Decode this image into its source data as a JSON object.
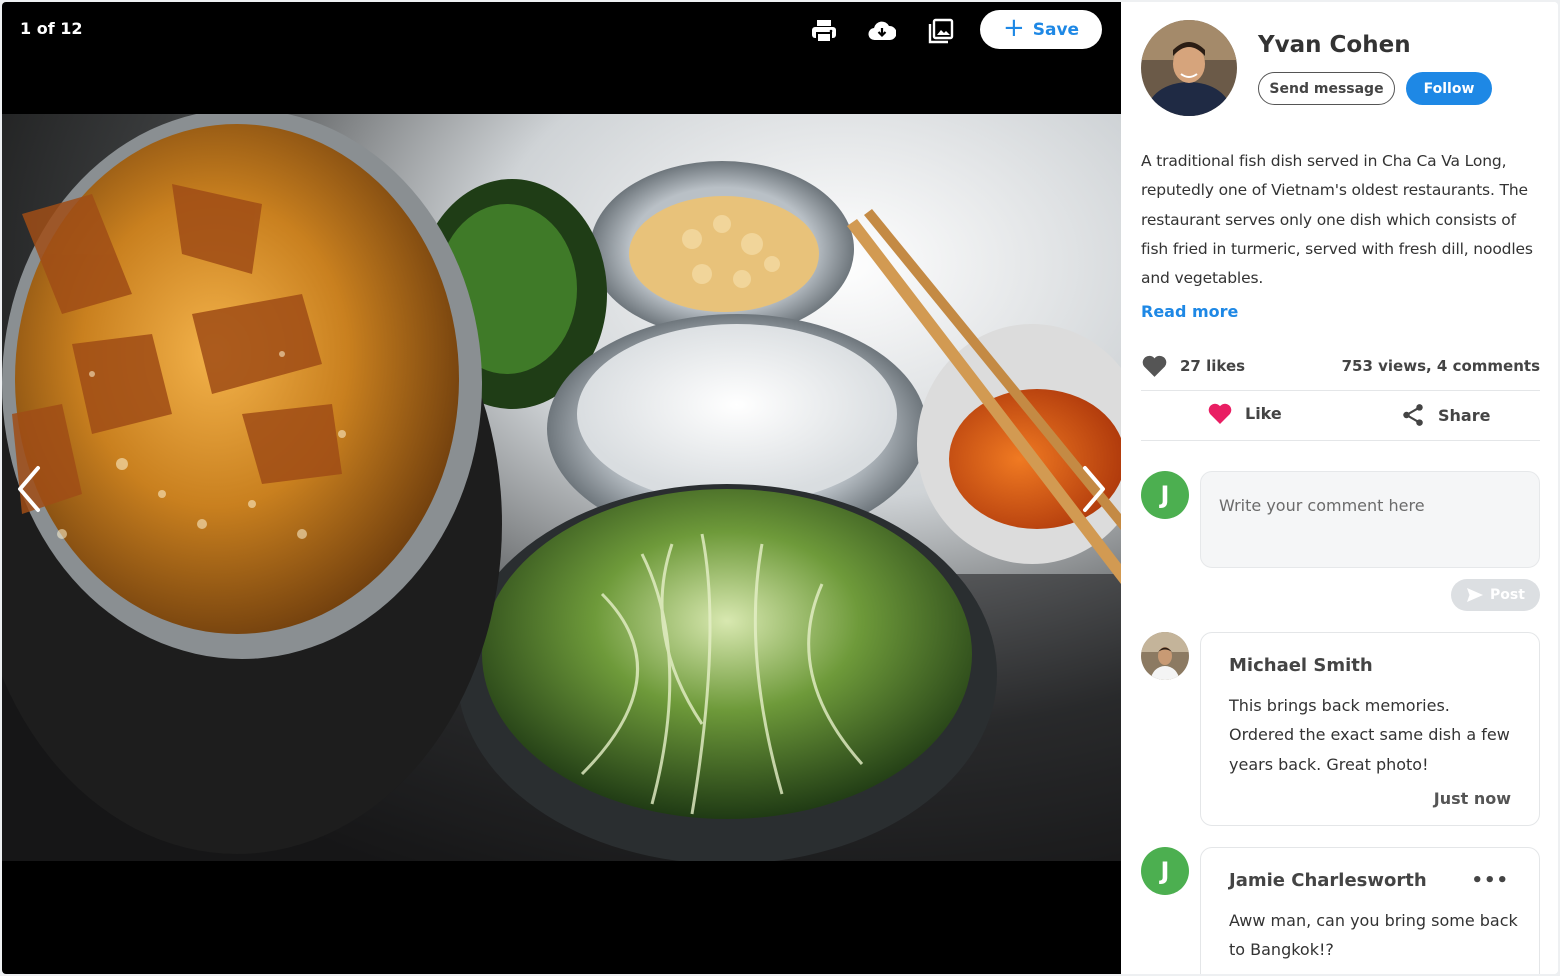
{
  "viewer": {
    "counter": "1 of 12",
    "save_label": "Save",
    "icons": [
      "print-icon",
      "download-icon",
      "gallery-icon",
      "plus-icon",
      "chevron-left-icon",
      "chevron-right-icon"
    ]
  },
  "author": {
    "name": "Yvan Cohen",
    "send_message_label": "Send message",
    "follow_label": "Follow"
  },
  "post": {
    "description": "A traditional fish dish served in Cha Ca Va Long, reputedly one of Vietnam's oldest restaurants. The restaurant serves only one dish which consists of fish fried in turmeric, served with fresh dill, noodles and vegetables.",
    "read_more_label": "Read more",
    "likes": "27 likes",
    "views_comments": "753 views, 4 comments",
    "like_label": "Like",
    "share_label": "Share"
  },
  "composer": {
    "avatar_letter": "J",
    "placeholder": "Write your comment here",
    "post_label": "Post"
  },
  "comments": [
    {
      "author": "Michael Smith",
      "text": "This brings back memories. Ordered the exact same dish a few years back. Great photo!",
      "time": "Just now"
    },
    {
      "author": "Jamie Charlesworth",
      "avatar_letter": "J",
      "text": "Aww man, can you bring some back to Bangkok!?",
      "more_label": "•••"
    }
  ],
  "colors": {
    "accent": "#1e88e5",
    "heart": "#e91e63",
    "avatar_green": "#4caf50"
  }
}
